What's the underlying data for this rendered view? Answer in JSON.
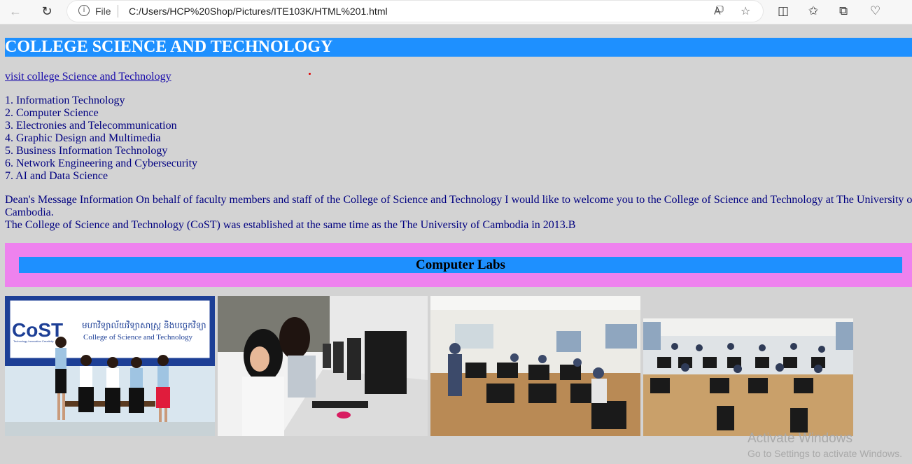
{
  "browser": {
    "file_label": "File",
    "url": "C:/Users/HCP%20Shop/Pictures/ITE103K/HTML%201.html"
  },
  "page": {
    "heading": "COLLEGE SCIENCE AND TECHNOLOGY",
    "link_text": "visit college Science and Technology",
    "programs": [
      "1. Information Technology",
      "2. Computer Science",
      "3. Electronies and Telecommunication",
      "4. Graphic Design and Multimedia",
      "5. Business Information Technology",
      "6. Network Engineering and Cybersecurity",
      "7. AI and Data Science"
    ],
    "dean_lines": [
      "Dean's Message Information On behalf of faculty members and staff of the College of Science and Technology I would like to welcome you to the College of Science and Technology at The University of",
      "Cambodia.",
      "The College of Science and Technology (CoST) was established at the same time as the The University of Cambodia in 2013.B"
    ],
    "labs_title": "Computer Labs",
    "photo1": {
      "logo_text": "CoST",
      "logo_sub": "Technology Innovation Creativity",
      "khmer_text": "មហាវិទ្យាល័យវិទ្យាសាស្ត្រ និងបច្ចេកវិទ្យា",
      "english_text": "College of Science and Technology"
    }
  },
  "watermark": {
    "title": "Activate Windows",
    "subtitle": "Go to Settings to activate Windows."
  }
}
